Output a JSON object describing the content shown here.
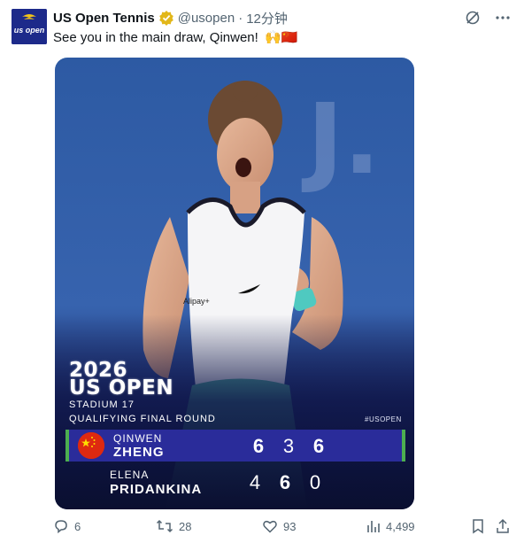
{
  "author": {
    "display_name": "US Open Tennis",
    "handle": "@usopen",
    "separator": "·",
    "time": "12分钟",
    "avatar_text": "us open"
  },
  "tweet": {
    "text": "See you in the main draw, Qinwen!",
    "emojis": "🙌🇨🇳"
  },
  "media": {
    "event_year": "2026",
    "event_name": "US OPEN",
    "court": "STADIUM 17",
    "round": "QUALIFYING FINAL ROUND",
    "hashtag": "#USOPEN",
    "sponsor_text": "Alipay+",
    "players": [
      {
        "first": "QINWEN",
        "last": "ZHENG",
        "scores": [
          "6",
          "3",
          "6"
        ],
        "winner": true
      },
      {
        "first": "ELENA",
        "last": "PRIDANKINA",
        "scores": [
          "4",
          "6",
          "0"
        ],
        "winner": false
      }
    ],
    "accent_color": "#2a2c9a",
    "winner_bar_color": "#4caf50"
  },
  "actions": {
    "replies": "6",
    "reposts": "28",
    "likes": "93",
    "views": "4,499"
  },
  "icons": [
    "verified-badge-icon",
    "grok-icon",
    "more-icon",
    "reply-icon",
    "repost-icon",
    "like-icon",
    "views-icon",
    "bookmark-icon",
    "share-icon"
  ]
}
